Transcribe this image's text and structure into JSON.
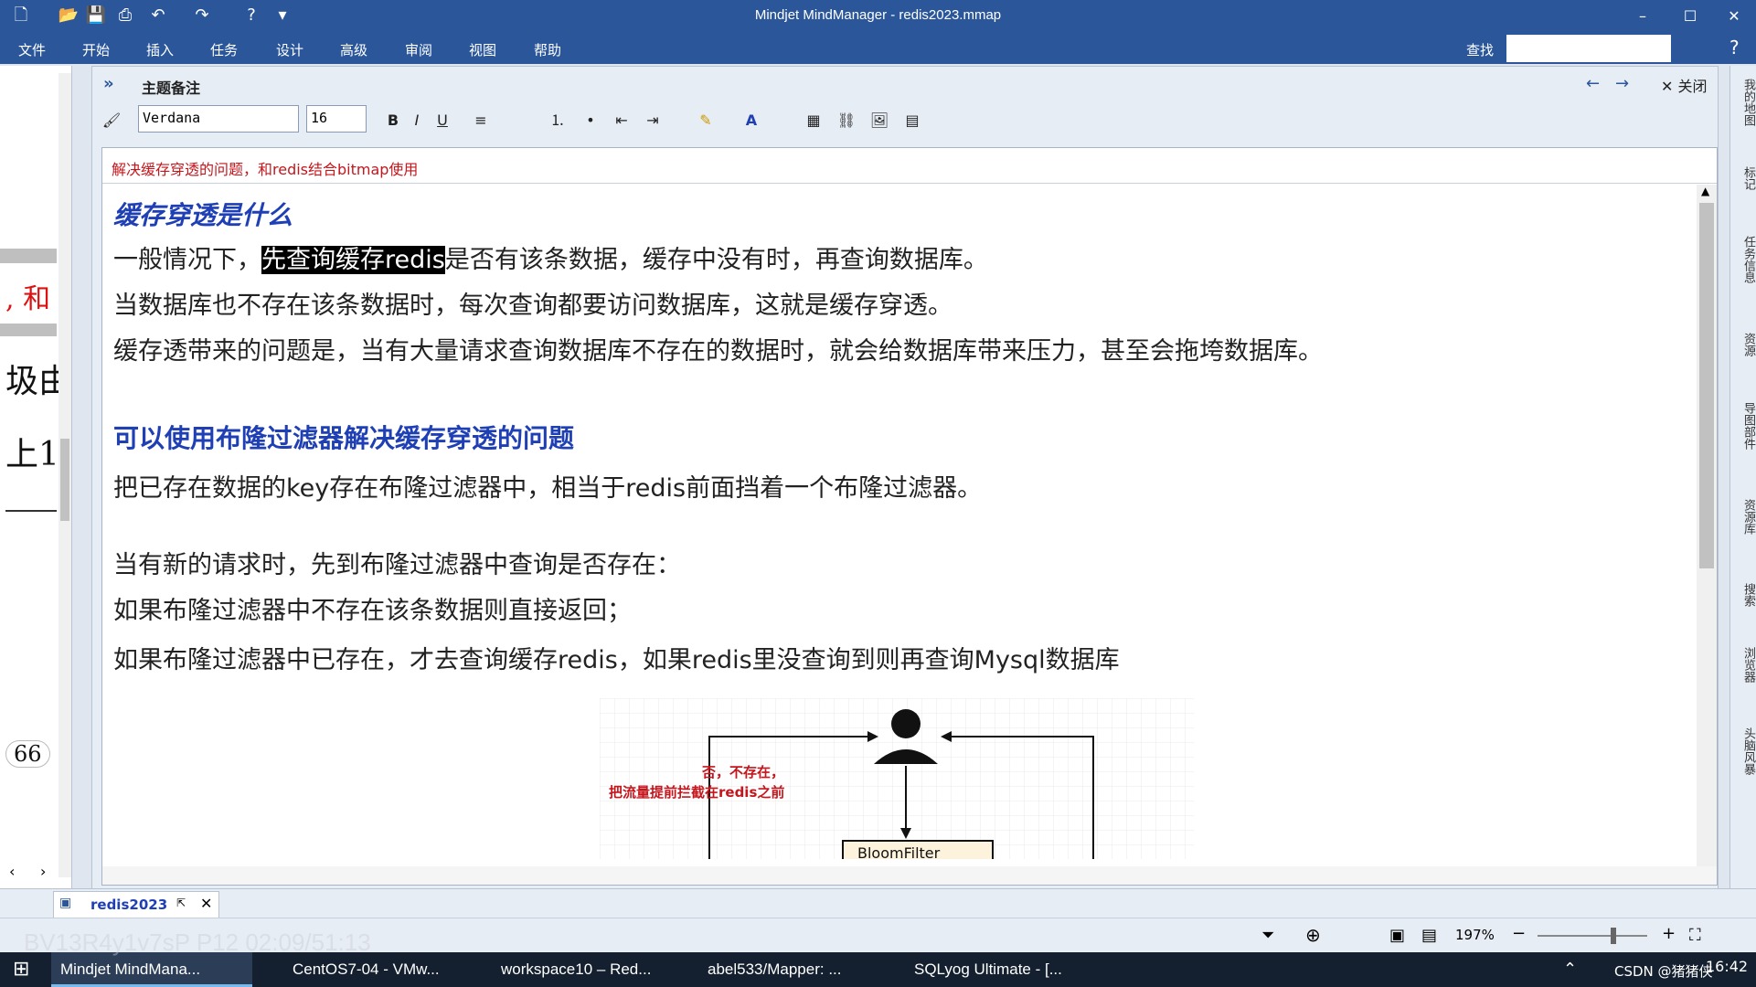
{
  "window": {
    "title": "Mindjet MindManager - redis2023.mmap"
  },
  "ribbon": {
    "tabs": [
      "文件",
      "开始",
      "插入",
      "任务",
      "设计",
      "高级",
      "审阅",
      "视图",
      "帮助"
    ],
    "search_label": "查找"
  },
  "left_panel": {
    "texts": [
      ", 和",
      "圾由",
      "上1",
      "66"
    ]
  },
  "notes": {
    "header_title": "主题备注",
    "close_label": "关闭",
    "font_family": "Verdana",
    "font_size": "16",
    "subject": "解决缓存穿透的问题，和redis结合bitmap使用",
    "heading1": "缓存穿透是什么",
    "p1_before": "一般情况下，",
    "p1_highlight": "先查询缓存redis",
    "p1_after": "是否有该条数据，缓存中没有时，再查询数据库。",
    "p2": "当数据库也不存在该条数据时，每次查询都要访问数据库，这就是缓存穿透。",
    "p3": "缓存透带来的问题是，当有大量请求查询数据库不存在的数据时，就会给数据库带来压力，甚至会拖垮数据库。",
    "heading2": "可以使用布隆过滤器解决缓存穿透的问题",
    "p4": "把已存在数据的key存在布隆过滤器中，相当于redis前面挡着一个布隆过滤器。",
    "p5": "当有新的请求时，先到布隆过滤器中查询是否存在：",
    "p6": "如果布隆过滤器中不存在该条数据则直接返回；",
    "p7": "如果布隆过滤器中已存在，才去查询缓存redis，如果redis里没查询到则再查询Mysql数据库"
  },
  "diagram": {
    "note_line1": "否，不存在，",
    "note_line2": "把流量提前拦截在redis之前",
    "box_label": "BloomFilter"
  },
  "right_sidebar": {
    "items": [
      "我的地图",
      "标记",
      "任务信息",
      "资源",
      "导图部件",
      "资源库",
      "搜索",
      "浏览器",
      "头脑风暴"
    ]
  },
  "doc_tab": {
    "name": "redis2023"
  },
  "status": {
    "zoom": "197%"
  },
  "taskbar": {
    "apps": [
      "Mindjet MindMana...",
      "CentOS7-04 - VMw...",
      "workspace10 – Red...",
      "abel533/Mapper: ...",
      "SQLyog Ultimate - [..."
    ],
    "tray_text": "CSDN @猪猪侠",
    "clock": "16:42"
  },
  "watermark": {
    "text": "BV13R4y1v7sP P12 02:09/51:13"
  },
  "colors": {
    "titlebar": "#2b579a",
    "subject_red": "#c4161c",
    "heading_blue": "#1f3fb5",
    "taskbar": "#14202f"
  }
}
